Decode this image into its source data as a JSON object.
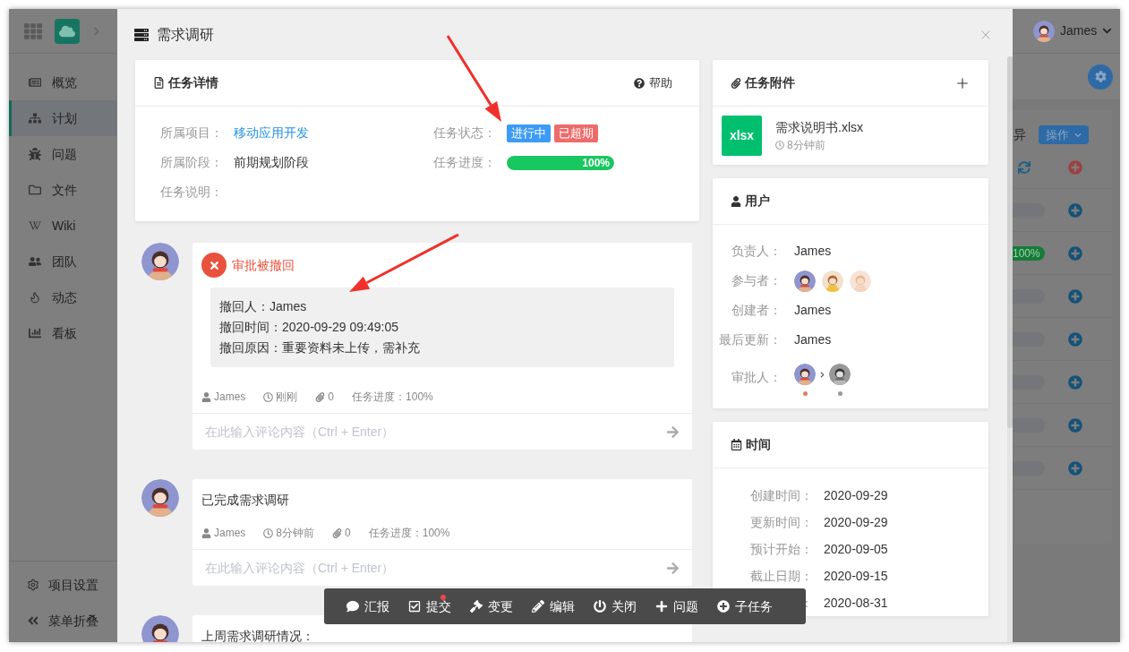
{
  "app": {
    "nav": [
      {
        "label": "概览",
        "selected": false
      },
      {
        "label": "计划",
        "selected": true
      },
      {
        "label": "问题",
        "selected": false
      },
      {
        "label": "文件",
        "selected": false
      },
      {
        "label": "Wiki",
        "selected": false
      },
      {
        "label": "团队",
        "selected": false
      },
      {
        "label": "动态",
        "selected": false
      },
      {
        "label": "看板",
        "selected": false
      }
    ],
    "footer": [
      {
        "label": "项目设置"
      },
      {
        "label": "菜单折叠"
      }
    ],
    "user": {
      "name": "James"
    },
    "column_text": "异",
    "action_button": "操作",
    "rows": [
      {
        "kind": "header"
      },
      {
        "kind": "bar"
      },
      {
        "kind": "labeled",
        "label": "100%"
      },
      {
        "kind": "bar"
      },
      {
        "kind": "bar"
      },
      {
        "kind": "bar"
      },
      {
        "kind": "bar"
      },
      {
        "kind": "bar"
      }
    ]
  },
  "modal": {
    "title": "需求调研",
    "details": {
      "title": "任务详情",
      "help": "帮助",
      "left": [
        {
          "label": "所属项目：",
          "kind": "link",
          "value": "移动应用开发"
        },
        {
          "label": "所属阶段：",
          "kind": "text",
          "value": "前期规划阶段"
        },
        {
          "label": "任务说明：",
          "kind": "empty"
        }
      ],
      "right": [
        {
          "label": "任务状态：",
          "kind": "tags",
          "tags": [
            {
              "text": "进行中",
              "color": "#3d9bf5"
            },
            {
              "text": "已超期",
              "color": "#ee6b6b"
            }
          ]
        },
        {
          "label": "任务进度：",
          "kind": "progress",
          "level": 1,
          "reading": "100%"
        }
      ]
    },
    "comments": [
      {
        "kind": "revoked",
        "title": "审批被撤回",
        "lines": [
          "撤回人：James",
          "撤回时间：2020-09-29 09:49:05",
          "撤回原因：重要资料未上传，需补充"
        ],
        "meta": {
          "author": "James",
          "time": "刚刚",
          "attachments": "0",
          "progress": "任务进度：100%"
        },
        "placeholder": "在此输入评论内容（Ctrl + Enter）"
      },
      {
        "kind": "text",
        "text": "已完成需求调研",
        "meta": {
          "author": "James",
          "time": "8分钟前",
          "attachments": "0",
          "progress": "任务进度：100%"
        },
        "placeholder": "在此输入评论内容（Ctrl + Enter）"
      },
      {
        "kind": "text",
        "text": "上周需求调研情况："
      }
    ],
    "toolbar": [
      {
        "label": "汇报",
        "notify": false
      },
      {
        "label": "提交",
        "notify": true
      },
      {
        "label": "变更",
        "notify": false
      },
      {
        "label": "编辑",
        "notify": false
      },
      {
        "label": "关闭",
        "notify": false
      },
      {
        "label": "问题",
        "notify": false
      },
      {
        "label": "子任务",
        "notify": false
      }
    ],
    "attachments": {
      "title": "任务附件",
      "files": [
        {
          "type": "xlsx",
          "name": "需求说明书.xlsx",
          "time": "8分钟前"
        }
      ]
    },
    "users": {
      "title": "用户",
      "rows": [
        {
          "label": "负责人：",
          "kind": "text",
          "value": "James"
        },
        {
          "label": "参与者：",
          "kind": "avatars",
          "avatars": [
            {
              "kind": "boy"
            },
            {
              "kind": "girl"
            },
            {
              "kind": "blonde"
            }
          ]
        },
        {
          "label": "创建者：",
          "kind": "text",
          "value": "James"
        },
        {
          "label": "最后更新：",
          "kind": "text",
          "value": "James"
        },
        {
          "label": "审批人：",
          "kind": "flow",
          "steps": [
            {
              "kind": "boy",
              "done": true
            },
            {
              "kind": "boy",
              "done": false
            }
          ]
        }
      ]
    },
    "time": {
      "title": "时间",
      "rows": [
        {
          "label": "创建时间：",
          "value": "2020-09-29"
        },
        {
          "label": "更新时间：",
          "value": "2020-09-29"
        },
        {
          "label": "预计开始：",
          "value": "2020-09-05"
        },
        {
          "label": "截止日期：",
          "value": "2020-09-15"
        },
        {
          "label": "：",
          "value": "2020-08-31"
        }
      ]
    },
    "annotations": [
      {
        "kind": "arrow"
      },
      {
        "kind": "arrow"
      }
    ]
  }
}
